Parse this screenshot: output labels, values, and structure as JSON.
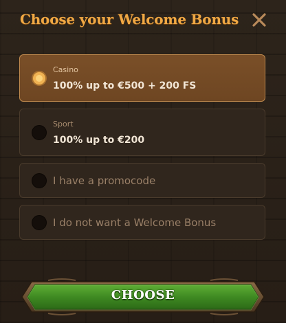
{
  "header": {
    "title": "Choose your Welcome Bonus",
    "close_icon": "close-icon"
  },
  "options": [
    {
      "category": "Casino",
      "value": "100% up to €500 + 200 FS",
      "selected": true
    },
    {
      "category": "Sport",
      "value": "100% up to €200",
      "selected": false
    },
    {
      "label": "I have a promocode",
      "selected": false
    },
    {
      "label": "I do not want a Welcome Bonus",
      "selected": false
    }
  ],
  "footer": {
    "choose_label": "CHOOSE"
  },
  "colors": {
    "title": "#f0a844",
    "selected_bg": "#6e4622",
    "button_green": "#3f8a22"
  }
}
